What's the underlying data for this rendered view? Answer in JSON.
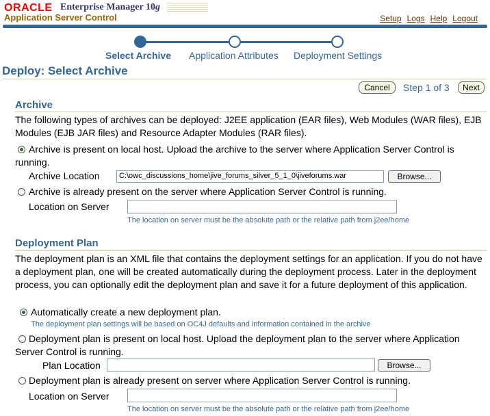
{
  "header": {
    "brand": "ORACLE",
    "product": "Enterprise Manager 10",
    "product_suffix": "g",
    "subtitle": "Application Server Control",
    "nav": [
      "Setup",
      "Logs",
      "Help",
      "Logout"
    ]
  },
  "train": {
    "steps": [
      "Select Archive",
      "Application Attributes",
      "Deployment Settings"
    ],
    "current_index": 0
  },
  "page": {
    "title": "Deploy: Select Archive",
    "cancel_label": "Cancel",
    "step_text": "Step 1 of 3",
    "next_label": "Next"
  },
  "archive": {
    "heading": "Archive",
    "description": "The following types of archives can be deployed: J2EE application (EAR files), Web Modules (WAR files), EJB Modules (EJB JAR files) and Resource Adapter Modules (RAR files).",
    "option_local": "Archive is present on local host. Upload the archive to the server where Application Server Control is running.",
    "location_label": "Archive Location",
    "location_value": "C:\\owc_discussions_home\\jive_forums_silver_5_1_0\\jiveforums.war",
    "browse_label": "Browse...",
    "option_server": "Archive is already present on the server where Application Server Control is running.",
    "server_location_label": "Location on Server",
    "server_location_value": "",
    "server_hint": "The location on server must be the absolute path or the relative path from j2ee/home",
    "selected": "local"
  },
  "plan": {
    "heading": "Deployment Plan",
    "description": "The deployment plan is an XML file that contains the deployment settings for an application. If you do not have a deployment plan, one will be created automatically during the deployment process. Later in the deployment process, you can optionally edit the deployment plan and save it for a future deployment of this application.",
    "option_auto": "Automatically create a new deployment plan.",
    "auto_hint": "The deployment plan settings will be based on OC4J defaults and information contained in the archive",
    "option_local": "Deployment plan is present on local host. Upload the deployment plan to the server where Application Server Control is running.",
    "plan_location_label": "Plan Location",
    "plan_location_value": "",
    "browse_label": "Browse...",
    "option_server": "Deployment plan is already present on server where Application Server Control is running.",
    "server_location_label": "Location on Server",
    "server_location_value": "",
    "server_hint": "The location on server must be the absolute path or the relative path from j2ee/home",
    "selected": "auto"
  },
  "colors": {
    "accent": "#336699",
    "brand_red": "#ff0000",
    "link": "#663300",
    "rule": "#cccc99"
  }
}
